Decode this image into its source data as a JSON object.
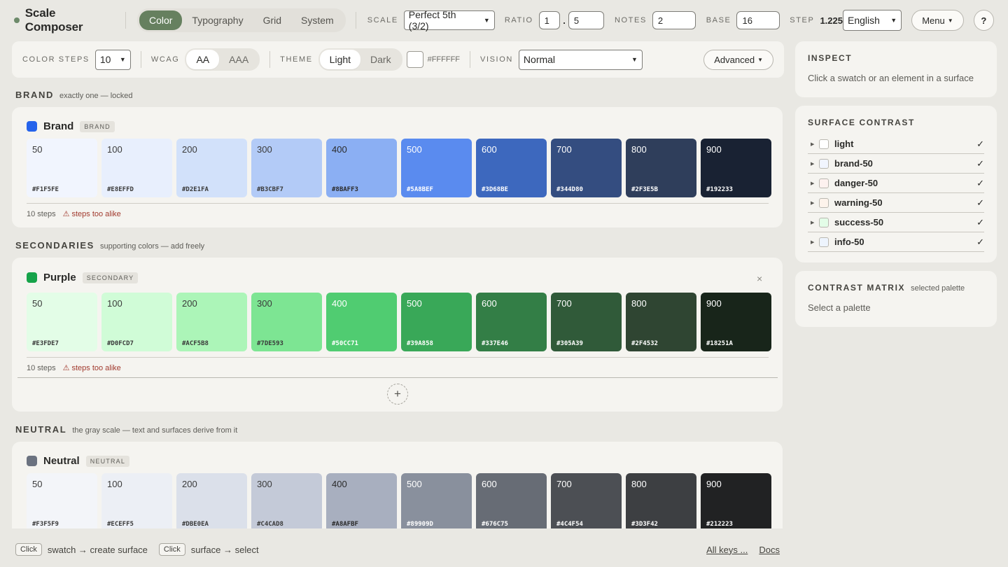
{
  "app": {
    "title": "Scale Composer"
  },
  "tabs": [
    {
      "label": "Color",
      "active": true
    },
    {
      "label": "Typography",
      "active": false
    },
    {
      "label": "Grid",
      "active": false
    },
    {
      "label": "System",
      "active": false
    }
  ],
  "topbar": {
    "scale_label": "SCALE",
    "scale_value": "Perfect 5th (3/2)",
    "ratio_label": "RATIO",
    "ratio_a": "1",
    "ratio_sep": ".",
    "ratio_b": "5",
    "notes_label": "NOTES",
    "notes_value": "2",
    "base_label": "BASE",
    "base_value": "16",
    "step_label": "STEP",
    "step_value": "1.225",
    "language": "English",
    "menu_label": "Menu",
    "help_label": "?"
  },
  "toolbar": {
    "color_steps_label": "COLOR STEPS",
    "color_steps_value": "10",
    "wcag_label": "WCAG",
    "wcag_options": [
      {
        "label": "AA",
        "active": true
      },
      {
        "label": "AAA",
        "active": false
      }
    ],
    "theme_label": "THEME",
    "theme_options": [
      {
        "label": "Light",
        "active": true
      },
      {
        "label": "Dark",
        "active": false
      }
    ],
    "bg_color": "#FFFFFF",
    "vision_label": "VISION",
    "vision_value": "Normal",
    "advanced_label": "Advanced"
  },
  "sections": {
    "brand": {
      "title": "BRAND",
      "subtitle": "exactly one — locked"
    },
    "secondaries": {
      "title": "SECONDARIES",
      "subtitle": "supporting colors — add freely"
    },
    "neutral": {
      "title": "NEUTRAL",
      "subtitle": "the gray scale — text and surfaces derive from it"
    }
  },
  "palettes": [
    {
      "name": "Brand",
      "tag": "BRAND",
      "dot": "#2563EB",
      "steps_text": "10 steps",
      "warning": "steps too alike",
      "swatches": [
        {
          "step": "50",
          "hex": "#F1F5FE",
          "fg": "#3A3A3A"
        },
        {
          "step": "100",
          "hex": "#E8EFFD",
          "fg": "#3A3A3A"
        },
        {
          "step": "200",
          "hex": "#D2E1FA",
          "fg": "#3A3A3A"
        },
        {
          "step": "300",
          "hex": "#B3CBF7",
          "fg": "#3A3A3A"
        },
        {
          "step": "400",
          "hex": "#8BAFF3",
          "fg": "#2A2A2A"
        },
        {
          "step": "500",
          "hex": "#5A8BEF",
          "fg": "#FFFFFF"
        },
        {
          "step": "600",
          "hex": "#3D68BE",
          "fg": "#FFFFFF"
        },
        {
          "step": "700",
          "hex": "#344D80",
          "fg": "#FFFFFF"
        },
        {
          "step": "800",
          "hex": "#2F3E5B",
          "fg": "#FFFFFF"
        },
        {
          "step": "900",
          "hex": "#192233",
          "fg": "#FFFFFF"
        }
      ]
    },
    {
      "name": "Purple",
      "tag": "SECONDARY",
      "dot": "#16A34A",
      "steps_text": "10 steps",
      "warning": "steps too alike",
      "close": "×",
      "swatches": [
        {
          "step": "50",
          "hex": "#E3FDE7",
          "fg": "#3A3A3A"
        },
        {
          "step": "100",
          "hex": "#D0FCD7",
          "fg": "#3A3A3A"
        },
        {
          "step": "200",
          "hex": "#ACF5B8",
          "fg": "#3A3A3A"
        },
        {
          "step": "300",
          "hex": "#7DE593",
          "fg": "#3A3A3A"
        },
        {
          "step": "400",
          "hex": "#50CC71",
          "fg": "#FFFFFF"
        },
        {
          "step": "500",
          "hex": "#39A858",
          "fg": "#FFFFFF"
        },
        {
          "step": "600",
          "hex": "#337E46",
          "fg": "#FFFFFF"
        },
        {
          "step": "700",
          "hex": "#305A39",
          "fg": "#FFFFFF"
        },
        {
          "step": "800",
          "hex": "#2F4532",
          "fg": "#FFFFFF"
        },
        {
          "step": "900",
          "hex": "#18251A",
          "fg": "#FFFFFF"
        }
      ]
    },
    {
      "name": "Neutral",
      "tag": "NEUTRAL",
      "dot": "#6B7280",
      "swatches": [
        {
          "step": "50",
          "hex": "#F3F5F9",
          "fg": "#3A3A3A"
        },
        {
          "step": "100",
          "hex": "#ECEFF5",
          "fg": "#3A3A3A"
        },
        {
          "step": "200",
          "hex": "#DBE0EA",
          "fg": "#3A3A3A"
        },
        {
          "step": "300",
          "hex": "#C4CAD8",
          "fg": "#3A3A3A"
        },
        {
          "step": "400",
          "hex": "#A8AFBF",
          "fg": "#2A2A2A"
        },
        {
          "step": "500",
          "hex": "#89909D",
          "fg": "#FFFFFF"
        },
        {
          "step": "600",
          "hex": "#676C75",
          "fg": "#FFFFFF"
        },
        {
          "step": "700",
          "hex": "#4C4F54",
          "fg": "#FFFFFF"
        },
        {
          "step": "800",
          "hex": "#3D3F42",
          "fg": "#FFFFFF"
        },
        {
          "step": "900",
          "hex": "#212223",
          "fg": "#FFFFFF"
        }
      ]
    }
  ],
  "add_palette_label": "+",
  "inspect": {
    "title": "INSPECT",
    "text": "Click a swatch or an element in a surface"
  },
  "surface_contrast": {
    "title": "SURFACE CONTRAST",
    "rows": [
      {
        "name": "light",
        "swatch": "#FFFFFF",
        "status": "✓"
      },
      {
        "name": "brand-50",
        "swatch": "#F1F5FE",
        "status": "✓"
      },
      {
        "name": "danger-50",
        "swatch": "#FDF1EF",
        "status": "✓"
      },
      {
        "name": "warning-50",
        "swatch": "#FDF3EB",
        "status": "✓"
      },
      {
        "name": "success-50",
        "swatch": "#E3FDE7",
        "status": "✓"
      },
      {
        "name": "info-50",
        "swatch": "#EDF4FD",
        "status": "✓"
      }
    ]
  },
  "contrast_matrix": {
    "title": "CONTRAST MATRIX",
    "subtitle": "selected palette",
    "text": "Select a palette"
  },
  "bottombar": {
    "hint1_key": "Click",
    "hint1_text": "swatch → create surface",
    "hint2_key": "Click",
    "hint2_text": "surface → select",
    "all_keys": "All keys ...",
    "docs": "Docs"
  }
}
